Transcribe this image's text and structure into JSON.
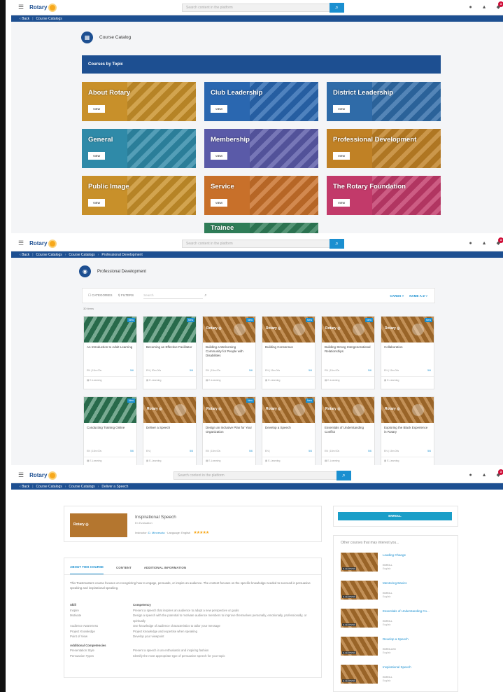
{
  "brand": {
    "name": "Rotary",
    "accent": "#1d4f91",
    "gold": "#f7a81b",
    "link": "#1a8fd0"
  },
  "search": {
    "placeholder": "Search content in the platform"
  },
  "notif_count": "3",
  "panel1": {
    "nav": [
      "Back",
      "Course Catalogs"
    ],
    "heading": "Course Catalog",
    "topics_title": "Courses by Topic",
    "view_label": "VIEW",
    "tiles": [
      {
        "title": "About Rotary",
        "color": "#c8902a"
      },
      {
        "title": "Club Leadership",
        "color": "#2a67b0"
      },
      {
        "title": "District Leadership",
        "color": "#2f6ba8"
      },
      {
        "title": "General",
        "color": "#2f8aa8"
      },
      {
        "title": "Membership",
        "color": "#5a5aa8"
      },
      {
        "title": "Professional Development",
        "color": "#c08125"
      },
      {
        "title": "Public Image",
        "color": "#c8902a"
      },
      {
        "title": "Service",
        "color": "#c8702a"
      },
      {
        "title": "The Rotary Foundation",
        "color": "#c23a6a"
      },
      {
        "title": "Trainee",
        "color": "#2f7d58"
      }
    ]
  },
  "panel2": {
    "nav": [
      "Back",
      "Course Catalogs",
      "Course Catalogs",
      "Professional Development"
    ],
    "heading": "Professional Development",
    "categories_label": "CATEGORIES",
    "filters_label": "FILTERS",
    "search_placeholder": "Search",
    "view_label": "CARDS",
    "sort_label": "NAME A-Z",
    "result_count": "30 items",
    "new_label": "New",
    "type_label": "E-Learning",
    "cards": [
      {
        "title": "An Introduction to Adult Learning",
        "lang": "EN",
        "dur": "15m 00s",
        "cnt": "5/6",
        "img": "g"
      },
      {
        "title": "Becoming an Effective Facilitator",
        "lang": "EN",
        "dur": "30m 00s",
        "cnt": "5/6",
        "img": "g"
      },
      {
        "title": "Building a Welcoming Community for People with Disabilities",
        "lang": "EN",
        "dur": "15m 00s",
        "cnt": "5/6",
        "img": "o"
      },
      {
        "title": "Building Consensus",
        "lang": "EN",
        "dur": "15m 00s",
        "cnt": "5/6",
        "img": "o"
      },
      {
        "title": "Building Strong Intergenerational Relationships",
        "lang": "EN",
        "dur": "15m 00s",
        "cnt": "5/6",
        "img": "o"
      },
      {
        "title": "Collaboration",
        "lang": "EN",
        "dur": "15m 00s",
        "cnt": "5/6",
        "img": "o"
      },
      {
        "title": "Conducting Training Online",
        "lang": "EN",
        "dur": "15m 00s",
        "cnt": "5/6",
        "img": "g"
      },
      {
        "title": "Deliver a Speech",
        "lang": "EN",
        "dur": "",
        "cnt": "5/6",
        "img": "o"
      },
      {
        "title": "Design an Inclusive Plan for Your Organization",
        "lang": "EN",
        "dur": "15m 00s",
        "cnt": "5/6",
        "img": "o"
      },
      {
        "title": "Develop a Speech",
        "lang": "EN",
        "dur": "",
        "cnt": "5/6",
        "img": "o"
      },
      {
        "title": "Essentials of Understanding Conflict",
        "lang": "EN",
        "dur": "15m 00s",
        "cnt": "5/6",
        "img": "o"
      },
      {
        "title": "Exploring the Black Experience in Rotary",
        "lang": "EN",
        "dur": "15m 00s",
        "cnt": "5/6",
        "img": "o"
      }
    ]
  },
  "panel3": {
    "nav": [
      "Back",
      "Course Catalogs",
      "Course Catalogs",
      "Deliver a Speech"
    ],
    "course_title": "Inspirational Speech",
    "course_sub": "En Evaluation",
    "instructor_label": "Instructor:",
    "instructor": "D. Minnesota",
    "language": "Language: English",
    "rating_stars": "★★★★★",
    "tabs": [
      "ABOUT THIS COURSE",
      "CONTENT",
      "ADDITIONAL INFORMATION"
    ],
    "description": "This Toastmasters course focuses on recognizing how to engage, persuade, or inspire an audience. The content focuses on the specific knowledge needed to succeed in persuasive speaking and inspirational speaking.",
    "skills_header": [
      "Skill",
      "Competency"
    ],
    "skills": [
      [
        "Inspire",
        "Present a speech that inspires an audience to adopt a new perspective or goals"
      ],
      [
        "Motivate",
        "Design a speech with the potential to motivate audience members to improve themselves personally, emotionally, professionally, or spiritually"
      ],
      [
        "Audience Awareness",
        "Use knowledge of audience characteristics to tailor your message"
      ],
      [
        "Project Knowledge",
        "Project knowledge and expertise when speaking"
      ],
      [
        "Point of View",
        "Develop your viewpoint"
      ]
    ],
    "additional_header": "Additional Competencies",
    "additional": [
      [
        "Presentation Style",
        "Present a speech in an enthusiastic and inspiring fashion"
      ],
      [
        "Persuasion Types",
        "Identify the most appropriate type of persuasive speech for your topic"
      ]
    ],
    "enroll_label": "ENROLL",
    "other_heading": "Other courses that may interest you...",
    "elearning_badge": "E-LEARNING",
    "other": [
      {
        "title": "Leading Change",
        "status": "ENROLL",
        "lang": "English"
      },
      {
        "title": "Mentoring Basics",
        "status": "ENROLL",
        "lang": "English"
      },
      {
        "title": "Essentials of Understanding Co...",
        "status": "ENROLL",
        "lang": "English"
      },
      {
        "title": "Develop a Speech",
        "status": "ENROLLED",
        "lang": "English"
      },
      {
        "title": "Inspirational Speech",
        "status": "ENROLL",
        "lang": "English"
      }
    ]
  }
}
